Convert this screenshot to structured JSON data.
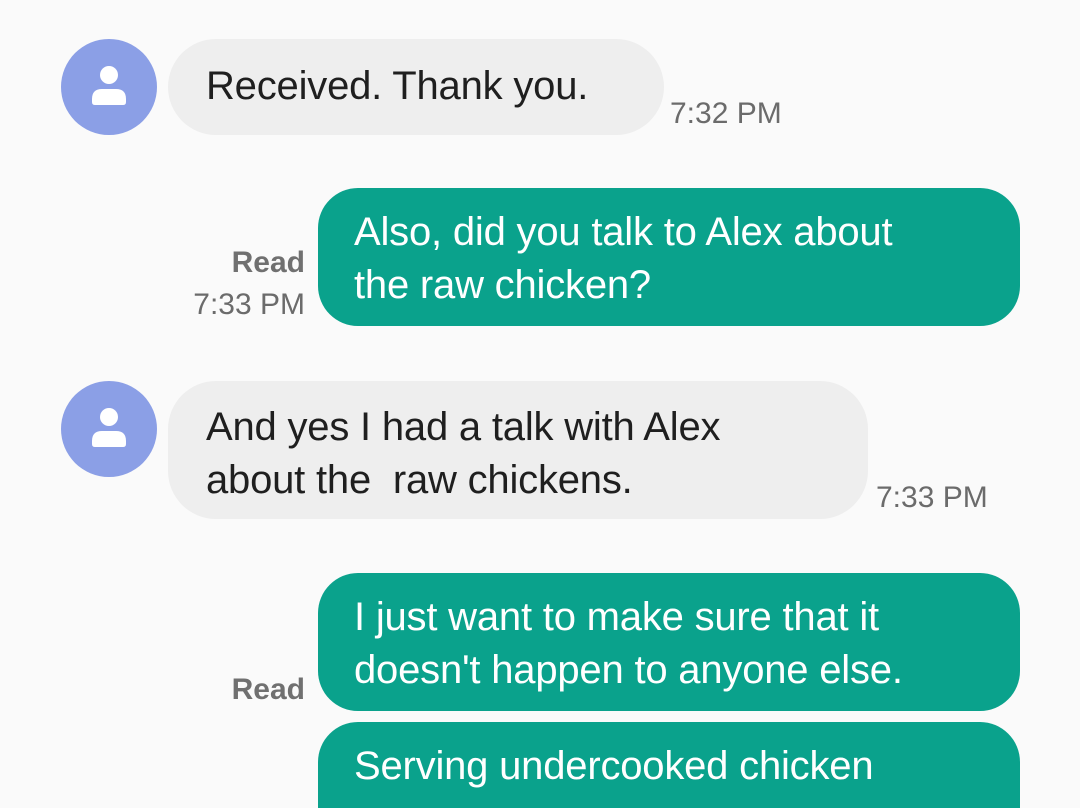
{
  "messages": [
    {
      "direction": "incoming",
      "avatar_icon": "person-icon",
      "lines": [
        "Received. Thank you."
      ],
      "time": "7:32 PM"
    },
    {
      "direction": "outgoing",
      "lines": [
        "Also, did you talk to Alex about",
        "the raw chicken?"
      ],
      "status": "Read",
      "time": "7:33 PM"
    },
    {
      "direction": "incoming",
      "avatar_icon": "person-icon",
      "lines": [
        "And yes I had a talk with Alex",
        "about the  raw chickens."
      ],
      "time": "7:33 PM"
    },
    {
      "direction": "outgoing",
      "lines": [
        "I just want to make sure that it",
        "doesn't happen to anyone else."
      ],
      "status": "Read"
    },
    {
      "direction": "outgoing",
      "lines": [
        "Serving undercooked chicken"
      ]
    }
  ],
  "colors": {
    "incoming_bubble": "#eeeeee",
    "outgoing_bubble": "#0aa28c",
    "avatar": "#8b9fe6",
    "background": "#fafafa"
  }
}
